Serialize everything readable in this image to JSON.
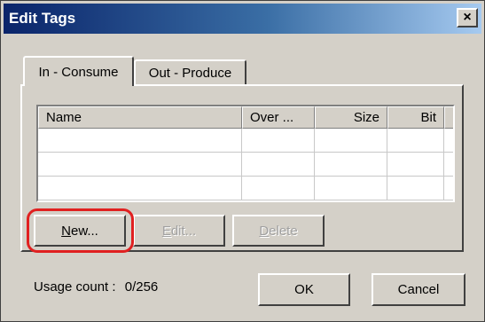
{
  "window": {
    "title": "Edit Tags",
    "close_glyph": "×"
  },
  "tabs": [
    {
      "label": "In - Consume",
      "active": true
    },
    {
      "label": "Out - Produce",
      "active": false
    }
  ],
  "table": {
    "columns": [
      "Name",
      "Over ...",
      "Size",
      "Bit"
    ],
    "rows": []
  },
  "buttons": {
    "new": {
      "label": "New...",
      "mnemonic": "N",
      "rest": "ew..."
    },
    "edit": {
      "label": "Edit...",
      "mnemonic": "E",
      "rest": "dit..."
    },
    "delete": {
      "label": "Delete",
      "mnemonic": "D",
      "rest": "elete"
    },
    "ok": "OK",
    "cancel": "Cancel"
  },
  "usage": {
    "label": "Usage count :",
    "value": "0/256"
  },
  "colors": {
    "highlight": "#e02020",
    "titlebar": "#0a246a",
    "face": "#d4d0c8"
  }
}
